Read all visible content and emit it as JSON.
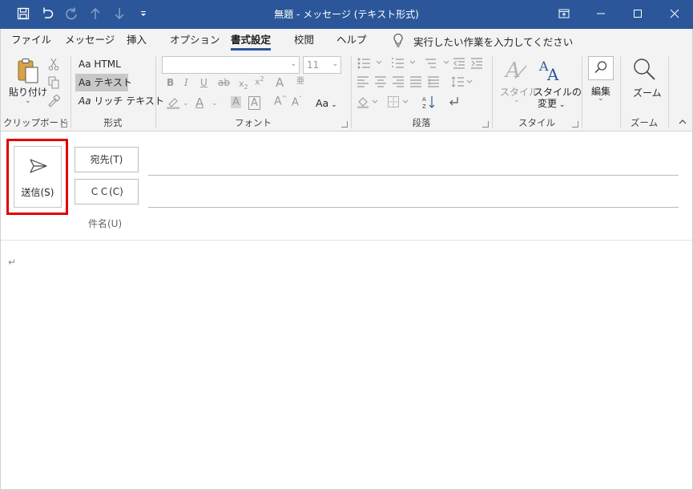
{
  "window": {
    "title": "無題 - メッセージ (テキスト形式)"
  },
  "tabs": [
    {
      "label": "ファイル"
    },
    {
      "label": "メッセージ"
    },
    {
      "label": "挿入"
    },
    {
      "label": "オプション"
    },
    {
      "label": "書式設定",
      "active": true
    },
    {
      "label": "校閲"
    },
    {
      "label": "ヘルプ"
    }
  ],
  "tell_me": {
    "placeholder": "実行したい作業を入力してください"
  },
  "ribbon": {
    "clipboard": {
      "group_label": "クリップボード",
      "paste_label": "貼り付け"
    },
    "format": {
      "group_label": "形式",
      "html_label": "HTML",
      "text_label": "テキスト",
      "rich_label": "リッチ テキスト",
      "aa_prefix": "Aa",
      "selected": "テキスト"
    },
    "font": {
      "group_label": "フォント",
      "font_name_value": "",
      "font_size_value": "11",
      "change_case_label": "Aa"
    },
    "paragraph": {
      "group_label": "段落"
    },
    "style": {
      "group_label": "スタイル",
      "styles_label": "スタイル",
      "change_styles_line1": "スタイルの",
      "change_styles_line2": "変更"
    },
    "editing": {
      "edit_label": "編集"
    },
    "zoom": {
      "group_label": "ズーム",
      "zoom_label": "ズーム"
    }
  },
  "compose": {
    "send_label": "送信(S)",
    "to_label": "宛先(T)",
    "cc_label": "ＣＣ(C)",
    "subject_label": "件名(U)",
    "to_value": "",
    "cc_value": "",
    "subject_value": "",
    "body_mark": "↵"
  },
  "colors": {
    "titlebar": "#2b579a",
    "highlight_border": "#e00000"
  }
}
